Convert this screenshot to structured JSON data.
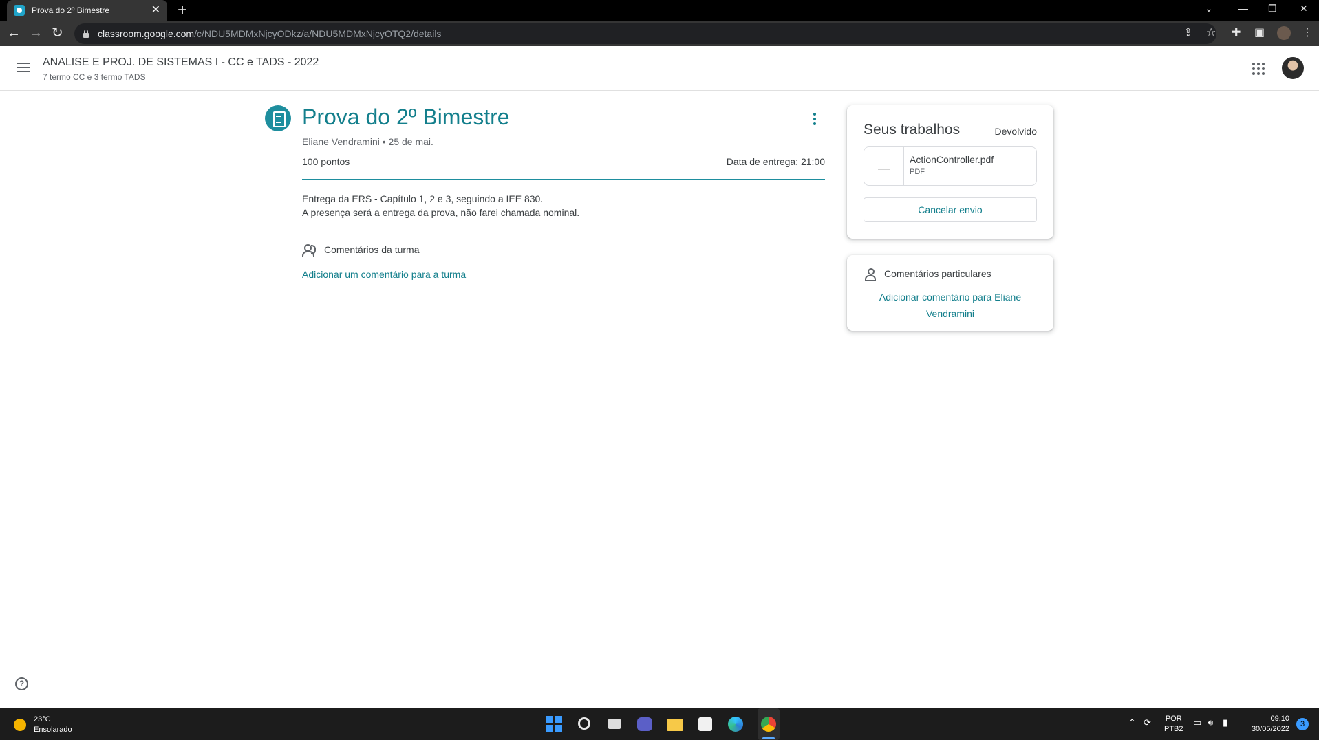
{
  "browser": {
    "tab_title": "Prova do 2º Bimestre",
    "tab_close": "✕",
    "new_tab": "+",
    "url_host": "classroom.google.com",
    "url_path": "/c/NDU5MDMxNjcyODkz/a/NDU5MDMxNjcyOTQ2/details"
  },
  "header": {
    "course_title": "ANALISE E PROJ. DE SISTEMAS I - CC e TADS - 2022",
    "course_subtitle": "7 termo CC e 3 termo TADS"
  },
  "assignment": {
    "title": "Prova do 2º Bimestre",
    "meta": "Eliane Vendramini • 25 de mai.",
    "points": "100 pontos",
    "due": "Data de entrega: 21:00",
    "description_line1": "Entrega da ERS - Capítulo 1, 2 e 3, seguindo a IEE 830.",
    "description_line2": "A presença será a entrega da prova, não farei chamada nominal.",
    "class_comments_label": "Comentários da turma",
    "add_class_comment": "Adicionar um comentário para a turma"
  },
  "work_card": {
    "title": "Seus trabalhos",
    "status": "Devolvido",
    "attachment_name": "ActionController.pdf",
    "attachment_type": "PDF",
    "cancel_button": "Cancelar envio"
  },
  "private_card": {
    "label": "Comentários particulares",
    "add_private": "Adicionar comentário para Eliane Vendramini"
  },
  "help": {
    "label": "?"
  },
  "taskbar": {
    "weather_temp": "23°C",
    "weather_desc": "Ensolarado",
    "lang_line1": "POR",
    "lang_line2": "PTB2",
    "time": "09:10",
    "date": "30/05/2022",
    "notifications": "3"
  },
  "colors": {
    "accent": "#137f8c",
    "assignment_icon": "#1e8e9e"
  }
}
